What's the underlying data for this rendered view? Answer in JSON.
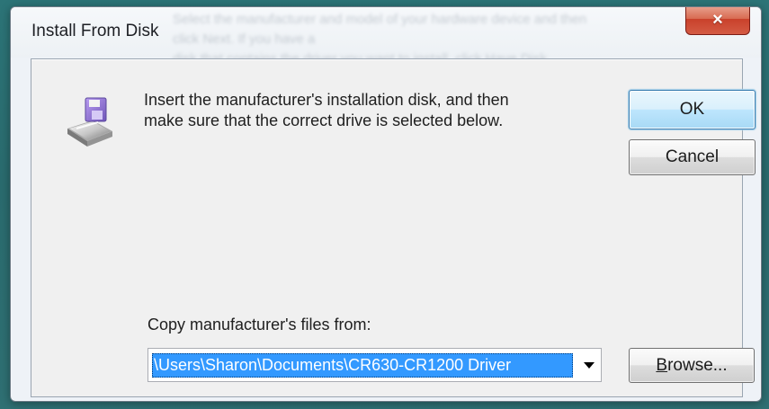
{
  "dialog": {
    "title": "Install From Disk",
    "close_icon": "close-icon",
    "background_title_text": [
      "Select the manufacturer and model of your hardware device and then click Next. If you have a",
      "disk that contains the driver you want to install, click Have Disk."
    ],
    "message_lines": [
      "Insert the manufacturer's installation disk, and then",
      "make sure that the correct drive is selected below."
    ],
    "buttons": {
      "ok": "OK",
      "cancel": "Cancel",
      "browse": "Browse..."
    },
    "copy_label": "Copy manufacturer's files from:",
    "source_path": "\\Users\\Sharon\\Documents\\CR630-CR1200 Driver",
    "icons": {
      "disk": "floppy-disk-icon",
      "dropdown": "chevron-down-icon"
    },
    "colors": {
      "selection": "#3399ff",
      "close_button": "#d45b44",
      "desktop": "#2f6f72"
    }
  }
}
